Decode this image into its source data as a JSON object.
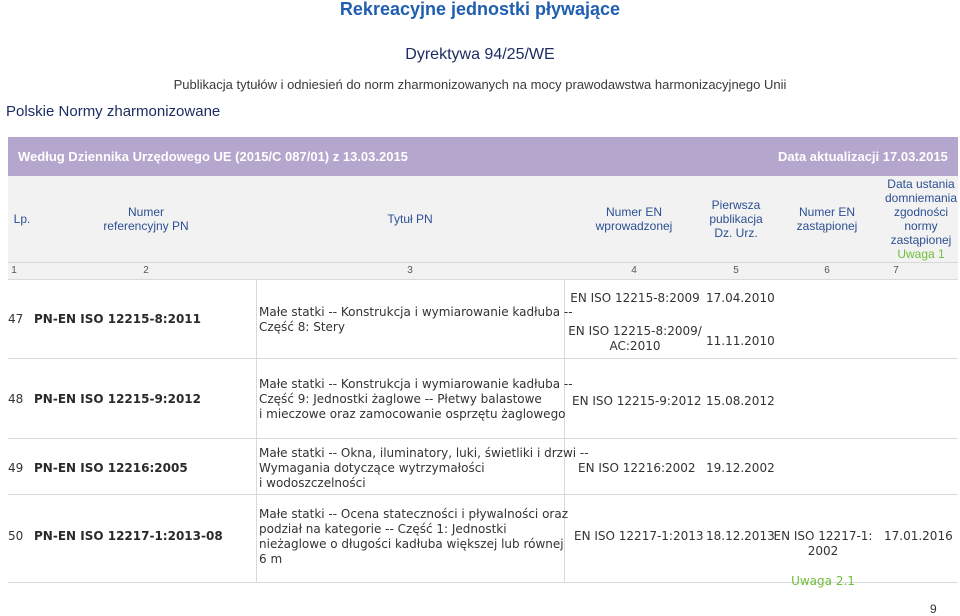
{
  "page_title": "Rekreacyjne jednostki pływające",
  "directive": "Dyrektywa 94/25/WE",
  "publication": "Publikacja tytułów i odniesień do norm zharmonizowanych na mocy prawodawstwa harmonizacyjnego Unii",
  "harmonized_title": "Polskie Normy zharmonizowane",
  "banner": {
    "left": "Według Dziennika Urzędowego UE (2015/C 087/01) z 13.03.2015",
    "right": "Data aktualizacji 17.03.2015"
  },
  "colors": {
    "title_blue": "#1f5eb0",
    "dark_blue": "#1c2d63",
    "banner_purple": "#b4a6cc",
    "header_text": "#2c4f93",
    "warning_green": "#6fbf3b"
  },
  "table": {
    "headers": {
      "lp": "Lp.",
      "ref": "Numer\nreferencyjny PN",
      "title": "Tytuł PN",
      "en_new": "Numer EN\nwprowadzonej",
      "first_pub": "Pierwsza\npublikacja\nDz. Urz.",
      "en_old": "Numer EN\nzastąpionej",
      "date_end": "Data ustania\ndomniemania\nzgodności\nnormy\nzastąpionej",
      "date_end_note": "Uwaga 1"
    },
    "column_numbers": [
      "1",
      "2",
      "3",
      "4",
      "5",
      "6",
      "7"
    ],
    "rows": [
      {
        "lp": "47",
        "ref": "PN-EN ISO 12215-8:2011",
        "title": "Małe statki -- Konstrukcja i wymiarowanie kadłuba --\nCzęść 8: Stery",
        "en_new_1": "EN ISO 12215-8:2009",
        "pub_1": "17.04.2010",
        "en_new_2": "EN ISO 12215-8:2009/\nAC:2010",
        "pub_2": "11.11.2010"
      },
      {
        "lp": "48",
        "ref": "PN-EN ISO 12215-9:2012",
        "title": "Małe statki -- Konstrukcja i wymiarowanie kadłuba --\nCzęść 9: Jednostki żaglowe -- Płetwy balastowe\ni mieczowe oraz zamocowanie osprzętu żaglowego",
        "en_new": "EN ISO 12215-9:2012",
        "pub": "15.08.2012"
      },
      {
        "lp": "49",
        "ref": "PN-EN ISO 12216:2005",
        "title": "Małe statki -- Okna, iluminatory, luki, świetliki i drzwi --\nWymagania dotyczące wytrzymałości\ni wodoszczelności",
        "en_new": "EN ISO 12216:2002",
        "pub": "19.12.2002"
      },
      {
        "lp": "50",
        "ref": "PN-EN ISO 12217-1:2013-08",
        "title": "Małe statki -- Ocena stateczności i pływalności oraz\npodział na kategorie -- Część 1: Jednostki\nnieżaglowe o długości kadłuba większej lub równej\n6 m",
        "en_new": "EN ISO 12217-1:2013",
        "pub": "18.12.2013",
        "en_old": "EN ISO 12217-1:\n2002",
        "en_old_note": "Uwaga 2.1",
        "date_end": "17.01.2016"
      }
    ]
  },
  "page_number": "9"
}
